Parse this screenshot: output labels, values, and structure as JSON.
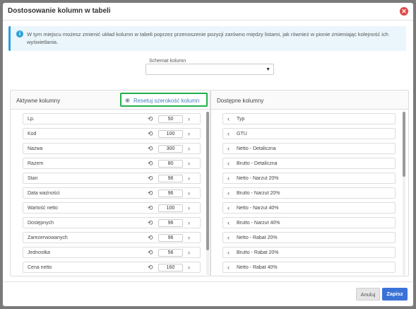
{
  "dialog": {
    "title": "Dostosowanie kolumn w tabeli",
    "close_icon": "close-icon",
    "info_icon": "info-icon",
    "info_text": "W tym miejscu możesz zmienić układ kolumn w tabeli poprzez przenoszenie pozycji zarówno między listami, jak również w pionie zmieniając kolejność ich wyświetlania."
  },
  "schema": {
    "label": "Schemat kolumn",
    "value": ""
  },
  "active_panel": {
    "title": "Aktywne kolumny",
    "reset_icon": "eye-icon",
    "reset_label": "Resetuj szerokość kolumn",
    "items": [
      {
        "label": "Lp.",
        "width": "50"
      },
      {
        "label": "Kod",
        "width": "100"
      },
      {
        "label": "Nazwa",
        "width": "300"
      },
      {
        "label": "Razem",
        "width": "80"
      },
      {
        "label": "Stan",
        "width": "96"
      },
      {
        "label": "Data ważności",
        "width": "96"
      },
      {
        "label": "Wartość netto",
        "width": "100"
      },
      {
        "label": "Dostępnych",
        "width": "96"
      },
      {
        "label": "Zarezerwowanych",
        "width": "96"
      },
      {
        "label": "Jednostka",
        "width": "56"
      },
      {
        "label": "Cena netto",
        "width": "160"
      }
    ],
    "scroll_position": 0,
    "scroll_visible_fraction": 0.85
  },
  "available_panel": {
    "title": "Dostępne kolumny",
    "items": [
      {
        "label": "Typ"
      },
      {
        "label": "GTU"
      },
      {
        "label": "Netto - Detaliczna"
      },
      {
        "label": "Brutto - Detaliczna"
      },
      {
        "label": "Netto - Narzut 20%"
      },
      {
        "label": "Brutto - Narzut 20%"
      },
      {
        "label": "Netto - Narzut 40%"
      },
      {
        "label": "Brutto - Narzut 40%"
      },
      {
        "label": "Netto - Rabat 20%"
      },
      {
        "label": "Brutto - Rabat 20%"
      },
      {
        "label": "Netto - Rabat 40%"
      }
    ],
    "scroll_position": 0,
    "scroll_visible_fraction": 0.4
  },
  "footer": {
    "cancel_label": "Anuluj",
    "save_label": "Zapisz"
  }
}
